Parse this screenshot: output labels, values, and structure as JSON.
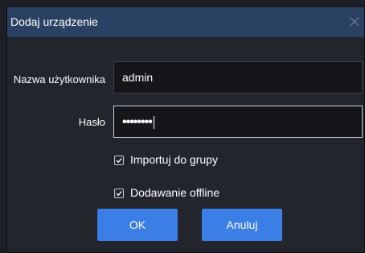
{
  "dialog": {
    "title": "Dodaj urządzenie",
    "close_icon": "close-icon"
  },
  "form": {
    "username_label": "Nazwa użytkownika",
    "username_value": "admin",
    "password_label": "Hasło",
    "password_value": "••••••••"
  },
  "options": [
    {
      "label": "Importuj do grupy",
      "checked": true
    },
    {
      "label": "Dodawanie offline",
      "checked": true
    }
  ],
  "buttons": {
    "ok_label": "OK",
    "cancel_label": "Anuluj"
  },
  "colors": {
    "title_bar": "#2b4163",
    "button": "#3a7ee6",
    "background": "#22252b"
  }
}
